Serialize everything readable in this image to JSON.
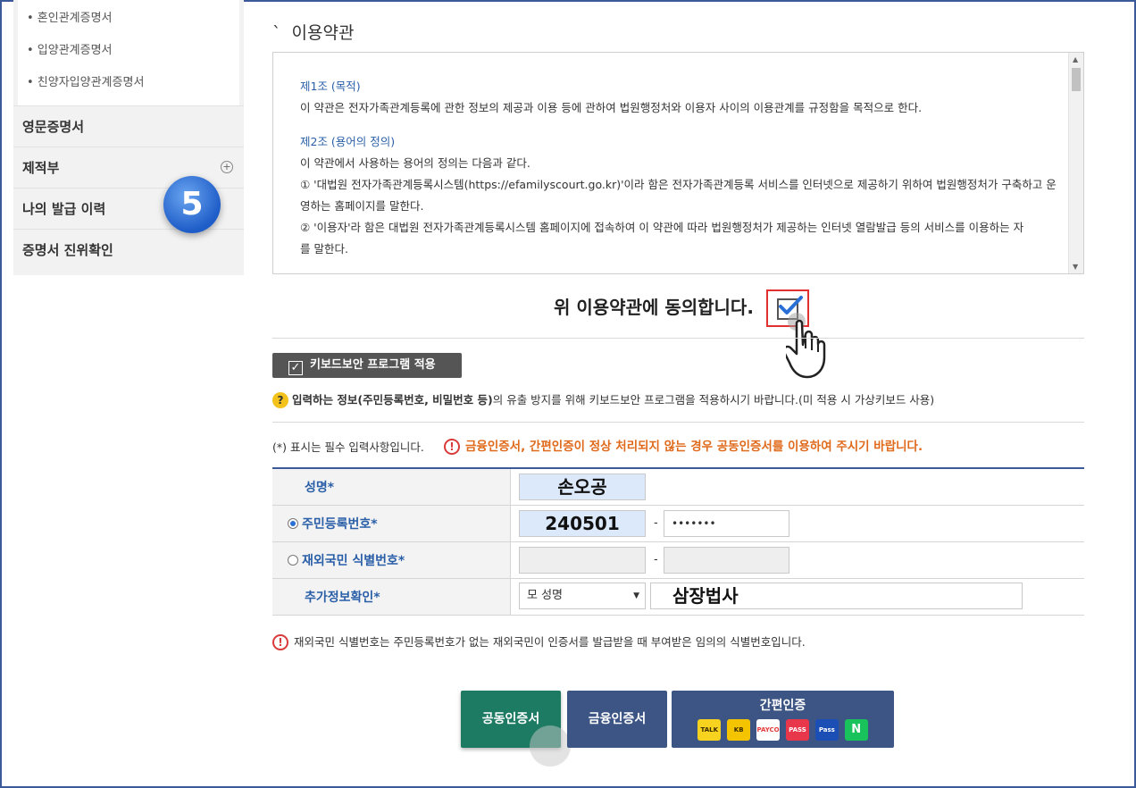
{
  "sidebar": {
    "sub_items": [
      "• 혼인관계증명서",
      "• 입양관계증명서",
      "• 친양자입양관계증명서"
    ],
    "sections": [
      "영문증명서",
      "제적부",
      "나의 발급 이력",
      "증명서 진위확인"
    ],
    "step_badge": "5"
  },
  "main": {
    "title_mark": "ˋ",
    "title": "이용약관",
    "terms": {
      "art1_title": "제1조 (목적)",
      "art1_text": "이 약관은 전자가족관계등록에 관한 정보의 제공과 이용 등에 관하여 법원행정처와 이용자 사이의 이용관계를 규정함을 목적으로 한다.",
      "art2_title": "제2조 (용어의 정의)",
      "art2_intro": "이 약관에서 사용하는 용어의 정의는 다음과 같다.",
      "art2_item1a": "① '대법원 전자가족관계등록시스템(https://efamilyscourt.go.kr)'이라 함은 전자가족관계등록 서비스를 인터넷으로 제공하기 위하여 법원행정처가 구축하고 운",
      "art2_item1b": "영하는 홈페이지를 말한다.",
      "art2_item2a": "② '이용자'라 함은 대법원 전자가족관계등록시스템 홈페이지에 접속하여 이 약관에 따라 법원행정처가 제공하는 인터넷 열람발급 등의 서비스를 이용하는 자",
      "art2_item2b": "를 말한다."
    },
    "agree_label": "위 이용약관에 동의합니다.",
    "agree_checked": true,
    "keyboard_button": "키보드보안 프로그램 적용",
    "keyboard_info_prefix": "입력하는 정보(주민등록번호, 비밀번호 등)",
    "keyboard_info_rest": "의 유출 방지를 위해 키보드보안 프로그램을 적용하시기 바랍니다.(미 적용 시 가상키보드 사용)",
    "required_note": "(*) 표시는 필수 입력사항입니다.",
    "warning": "금융인증서, 간편인증이 정상 처리되지 않는 경우 공동인증서를 이용하여 주시기 바랍니다.",
    "form": {
      "name_label": "성명",
      "name_value": "손오공",
      "rrn_label": "주민등록번호",
      "rrn_front": "240501",
      "rrn_back": "•••••••",
      "foreign_label": "재외국민 식별번호",
      "extra_label": "추가정보확인",
      "extra_select": "모 성명",
      "extra_value": "삼장법사",
      "star": "*",
      "dash": "-"
    },
    "foreign_note": "재외국민 식별번호는 주민등록번호가 없는 재외국민이 인증서를 발급받을 때 부여받은 임의의 식별번호입니다.",
    "buttons": {
      "joint_cert": "공동인증서",
      "finance_cert": "금융인증서",
      "simple_auth": "간편인증",
      "simple_icons": [
        "TALK",
        "KB",
        "PAYCO",
        "PASS",
        "Pass",
        "N"
      ]
    }
  }
}
